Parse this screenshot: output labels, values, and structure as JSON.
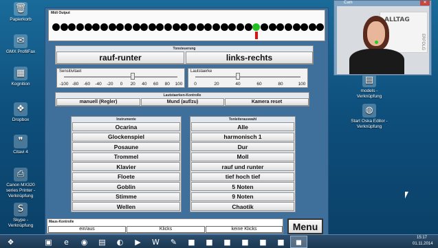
{
  "desktop_icons": [
    {
      "label": "Papierkorb",
      "icon": "recycle-bin-icon",
      "glyph": "🗑"
    },
    {
      "label": "GMX ProfilFax",
      "icon": "fax-icon",
      "glyph": "✉"
    },
    {
      "label": "Kognition",
      "icon": "image-file-icon",
      "glyph": "▦"
    },
    {
      "label": "Dropbox",
      "icon": "dropbox-icon",
      "glyph": "❖"
    },
    {
      "label": "Citavi 4",
      "icon": "citavi-icon",
      "glyph": "❞"
    },
    {
      "label": "Canon MX320 series Printer - Verknüpfung",
      "icon": "printer-icon",
      "glyph": "⎙"
    },
    {
      "label": "Skype - Verknüpfung",
      "icon": "skype-icon",
      "glyph": "S"
    },
    {
      "label": "models - Verknüpfung",
      "icon": "folder-shortcut-icon",
      "glyph": "▤"
    },
    {
      "label": "Start Oska Editor - Verknüpfung",
      "icon": "globe-shortcut-icon",
      "glyph": "◍"
    }
  ],
  "midi": {
    "title": "Midi Output",
    "dot_count": 34,
    "active_index": 25,
    "active_color": "#22c022",
    "marker_color": "#e01010"
  },
  "tonsteuerung": {
    "title": "Tonsteuerung",
    "left": "rauf-runter",
    "right": "links-rechts"
  },
  "sensitivity": {
    "label": "Sensitivitaet",
    "ticks": [
      "-100",
      "-80",
      "-60",
      "-40",
      "-20",
      "0",
      "20",
      "40",
      "60",
      "80",
      "100"
    ],
    "value": 20
  },
  "volume": {
    "label": "Lautstaerke",
    "ticks": [
      "0",
      "20",
      "40",
      "60",
      "80",
      "100"
    ],
    "value": 40
  },
  "lautstaerken": {
    "title": "Lautstaerken-Kontrolle",
    "buttons": [
      "manuell (Regler)",
      "Mund (auf/zu)",
      "Kamera reset"
    ]
  },
  "instruments": {
    "title": "Instrumente",
    "items": [
      "Ocarina",
      "Glockenspiel",
      "Posaune",
      "Trommel",
      "Klavier",
      "Floete",
      "Goblin",
      "Stimme",
      "Wellen"
    ]
  },
  "scales": {
    "title": "Tonleiterauswahl",
    "items": [
      "Alle",
      "harmonisch 1",
      "Dur",
      "Moll",
      "rauf und runter",
      "tief hoch tief",
      "5 Noten",
      "9 Noten",
      "Chaotik"
    ]
  },
  "mouse": {
    "title": "Maus-Kontrolle",
    "options": [
      "ein/aus",
      "Klicks",
      "keine Klicks"
    ]
  },
  "menu_label": "Menu",
  "cam": {
    "title": "Cam",
    "sign_text": "ALLTAG",
    "side_text": "ERFOLG"
  },
  "taskbar": {
    "time": "15:17",
    "date": "01.11.2014",
    "items": [
      "windows-start-icon",
      "explorer-icon",
      "ie-icon",
      "chrome-icon",
      "folder-icon",
      "firefox-icon",
      "media-icon",
      "word-icon",
      "paint-icon",
      "app-icon",
      "app-icon-2",
      "app-icon-3",
      "app-icon-4",
      "app-icon-5",
      "app-icon-6",
      "active-app-icon"
    ]
  }
}
